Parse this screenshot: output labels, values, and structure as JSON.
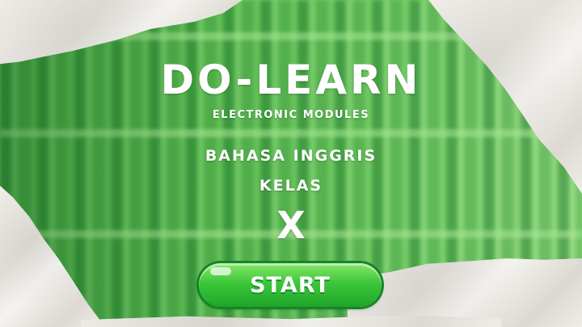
{
  "title": "DO-LEARN",
  "subtitle": "ELECTRONIC MODULES",
  "subject": "BAHASA INGGRIS",
  "class_label": "KELAS",
  "class_value": "X",
  "start_button": {
    "label": "START"
  },
  "colors": {
    "background_green": "#6fcf63",
    "button_green": "#3cc73a",
    "text": "#ffffff",
    "paper": "#eceae5"
  }
}
